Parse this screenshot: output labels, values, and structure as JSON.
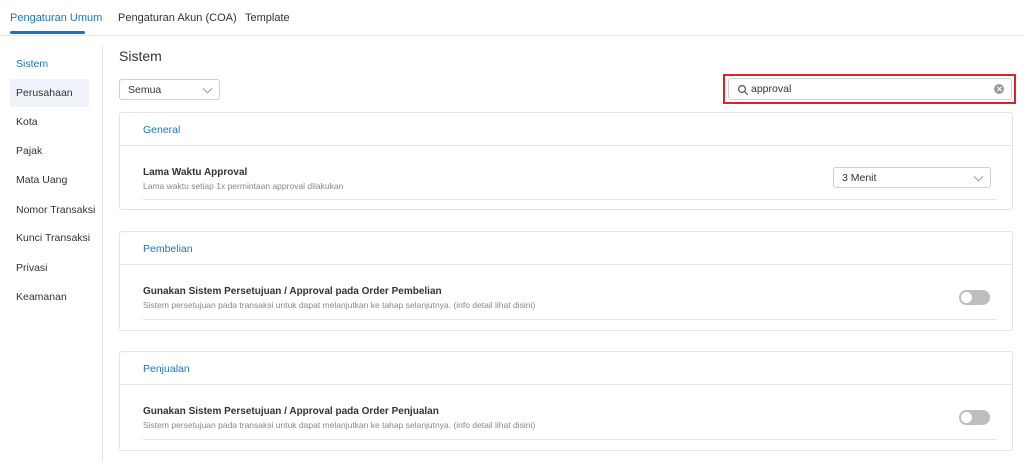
{
  "tabs": [
    {
      "label": "Pengaturan Umum",
      "active": true
    },
    {
      "label": "Pengaturan Akun (COA)",
      "active": false
    },
    {
      "label": "Template",
      "active": false
    }
  ],
  "sidebar": {
    "items": [
      {
        "label": "Sistem",
        "active": true
      },
      {
        "label": "Perusahaan",
        "active": false
      },
      {
        "label": "Kota",
        "active": false
      },
      {
        "label": "Pajak",
        "active": false
      },
      {
        "label": "Mata Uang",
        "active": false
      },
      {
        "label": "Nomor Transaksi",
        "active": false
      },
      {
        "label": "Kunci Transaksi",
        "active": false
      },
      {
        "label": "Privasi",
        "active": false
      },
      {
        "label": "Keamanan",
        "active": false
      }
    ]
  },
  "main": {
    "title": "Sistem",
    "filter": {
      "selected": "Semua"
    },
    "search": {
      "value": "approval"
    },
    "sections": [
      {
        "title": "General",
        "settings": [
          {
            "label": "Lama Waktu Approval",
            "description": "Lama waktu setiap 1x permintaan approval dilakukan",
            "control": "select",
            "value": "3 Menit"
          }
        ]
      },
      {
        "title": "Pembelian",
        "settings": [
          {
            "label": "Gunakan Sistem Persetujuan / Approval pada Order Pembelian",
            "description": "Sistem persetujuan pada transaksi untuk dapat melanjutkan ke tahap selanjutnya. (info detail lihat disini)",
            "control": "toggle",
            "enabled": false
          }
        ]
      },
      {
        "title": "Penjualan",
        "settings": [
          {
            "label": "Gunakan Sistem Persetujuan / Approval pada Order Penjualan",
            "description": "Sistem persetujuan pada transaksi untuk dapat melanjutkan ke tahap selanjutnya. (info detail lihat disini)",
            "control": "toggle",
            "enabled": false
          }
        ]
      }
    ]
  },
  "colors": {
    "accent": "#1a73c9",
    "highlight_border": "#d9232d",
    "toggle_off": "#bdbdbd"
  }
}
